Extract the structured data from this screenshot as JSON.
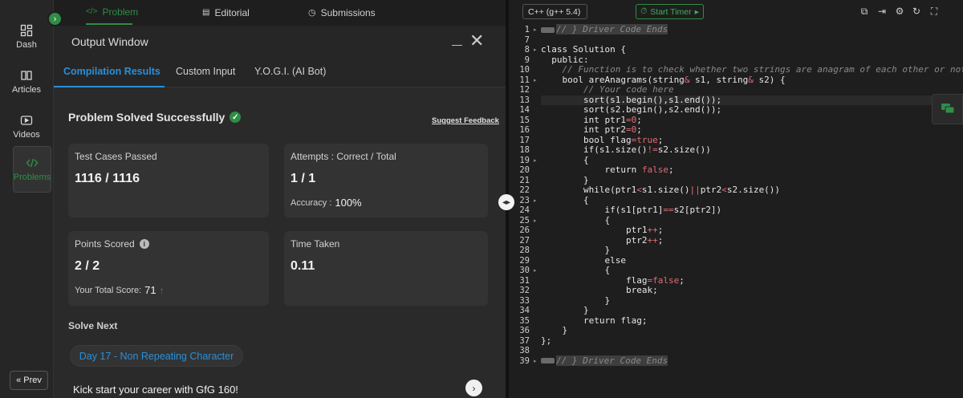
{
  "rail": {
    "items": [
      {
        "label": "Dash",
        "icon": "dashboard-icon"
      },
      {
        "label": "Articles",
        "icon": "book-icon"
      },
      {
        "label": "Videos",
        "icon": "video-icon"
      },
      {
        "label": "Problems",
        "icon": "code-icon",
        "active": true
      }
    ],
    "prev_label": "Prev"
  },
  "top_tabs": [
    {
      "label": "Problem",
      "icon": "code-icon",
      "active": true
    },
    {
      "label": "Editorial",
      "icon": "document-icon"
    },
    {
      "label": "Submissions",
      "icon": "clock-icon"
    }
  ],
  "output": {
    "title": "Output Window",
    "tabs": [
      "Compilation Results",
      "Custom Input",
      "Y.O.G.I. (AI Bot)"
    ],
    "status": "Problem Solved Successfully",
    "suggest_feedback": "Suggest Feedback",
    "cards": {
      "tests": {
        "label": "Test Cases Passed",
        "value": "1116 / 1116"
      },
      "attempts": {
        "label": "Attempts : Correct / Total",
        "value": "1 / 1",
        "sub_label": "Accuracy :",
        "sub_value": "100%"
      },
      "points": {
        "label": "Points Scored",
        "value": "2 / 2",
        "sub_label": "Your Total Score:",
        "sub_value": "71"
      },
      "time": {
        "label": "Time Taken",
        "value": "0.11"
      }
    },
    "solve_next_label": "Solve Next",
    "next_problem": "Day 17 - Non Repeating Character",
    "promo": "Kick start your career with GfG 160!"
  },
  "editor": {
    "language": "C++ (g++ 5.4)",
    "timer_label": "Start Timer",
    "toolbar_icons": [
      "copy-icon",
      "export-icon",
      "settings-icon",
      "reset-icon",
      "fullscreen-icon"
    ],
    "lines": [
      {
        "n": "1",
        "fold": true,
        "html": "<span class=\"fold-mark\"></span><span class=\"cmt\">// } Driver Code Ends</span>",
        "hl": true
      },
      {
        "n": "7",
        "html": ""
      },
      {
        "n": "8",
        "fold": true,
        "html": "class Solution {"
      },
      {
        "n": "9",
        "html": "  public:"
      },
      {
        "n": "10",
        "html": "    <span class=\"cmt\">// Function is to check whether two strings are anagram of each other or not.</span>"
      },
      {
        "n": "11",
        "fold": true,
        "html": "    bool areAnagrams(string<span class=\"op\">&amp;</span> s1, string<span class=\"op\">&amp;</span> s2) {"
      },
      {
        "n": "12",
        "html": "        <span class=\"cmt\">// Your code here</span>"
      },
      {
        "n": "13",
        "html": "        sort(s1.begin(),s1.end());",
        "cur": true
      },
      {
        "n": "14",
        "html": "        sort(s2.begin(),s2.end());"
      },
      {
        "n": "15",
        "html": "        int ptr1<span class=\"op\">=0</span>;"
      },
      {
        "n": "16",
        "html": "        int ptr2<span class=\"op\">=0</span>;"
      },
      {
        "n": "17",
        "html": "        bool flag<span class=\"op\">=true</span>;"
      },
      {
        "n": "18",
        "html": "        if(s1.size()<span class=\"op\">!=</span>s2.size())"
      },
      {
        "n": "19",
        "fold": true,
        "html": "        {"
      },
      {
        "n": "20",
        "html": "            return <span class=\"op\">false</span>;"
      },
      {
        "n": "21",
        "html": "        }"
      },
      {
        "n": "22",
        "html": "        while(ptr1<span class=\"op\">&lt;</span>s1.size()<span class=\"op\">||</span>ptr2<span class=\"op\">&lt;</span>s2.size())"
      },
      {
        "n": "23",
        "fold": true,
        "html": "        {"
      },
      {
        "n": "24",
        "html": "            if(s1[ptr1]<span class=\"op\">==</span>s2[ptr2])"
      },
      {
        "n": "25",
        "fold": true,
        "html": "            {"
      },
      {
        "n": "26",
        "html": "                ptr1<span class=\"op\">++</span>;"
      },
      {
        "n": "27",
        "html": "                ptr2<span class=\"op\">++</span>;"
      },
      {
        "n": "28",
        "html": "            }"
      },
      {
        "n": "29",
        "html": "            else"
      },
      {
        "n": "30",
        "fold": true,
        "html": "            {"
      },
      {
        "n": "31",
        "html": "                flag<span class=\"op\">=false</span>;"
      },
      {
        "n": "32",
        "html": "                break;"
      },
      {
        "n": "33",
        "html": "            }"
      },
      {
        "n": "34",
        "html": "        }"
      },
      {
        "n": "35",
        "html": "        return flag;"
      },
      {
        "n": "36",
        "html": "    }"
      },
      {
        "n": "37",
        "html": "};"
      },
      {
        "n": "38",
        "html": ""
      },
      {
        "n": "39",
        "fold": true,
        "html": "<span class=\"fold-mark\"></span><span class=\"cmt\">// } Driver Code Ends</span>",
        "hl": true
      }
    ]
  }
}
